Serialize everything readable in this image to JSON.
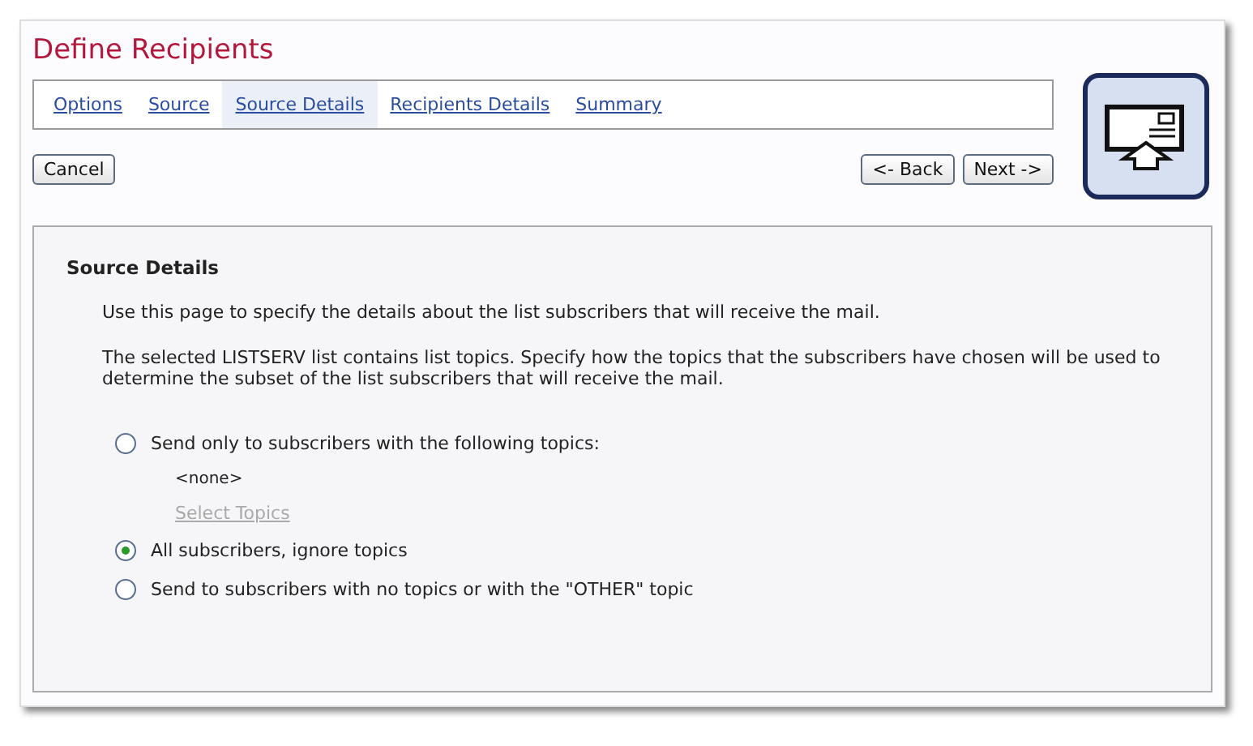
{
  "title": "Define Recipients",
  "tabs": [
    {
      "label": "Options",
      "selected": false
    },
    {
      "label": "Source",
      "selected": false
    },
    {
      "label": "Source Details",
      "selected": true
    },
    {
      "label": "Recipients Details",
      "selected": false
    },
    {
      "label": "Summary",
      "selected": false
    }
  ],
  "buttons": {
    "cancel": "Cancel",
    "back": "<- Back",
    "next": "Next ->"
  },
  "panel": {
    "heading": "Source Details",
    "paragraphs": [
      "Use this page to specify the details about the list subscribers that will receive the mail.",
      "The selected LISTSERV list contains list topics. Specify how the topics that the subscribers have chosen will be used to determine the subset of the list subscribers that will receive the mail."
    ],
    "options": [
      {
        "label": "Send only to subscribers with the following topics:",
        "selected": false,
        "topics": "<none>",
        "link": {
          "label": "Select Topics",
          "disabled": true
        }
      },
      {
        "label": "All subscribers, ignore topics",
        "selected": true
      },
      {
        "label": "Send to subscribers with no topics or with the \"OTHER\" topic",
        "selected": false
      }
    ]
  }
}
